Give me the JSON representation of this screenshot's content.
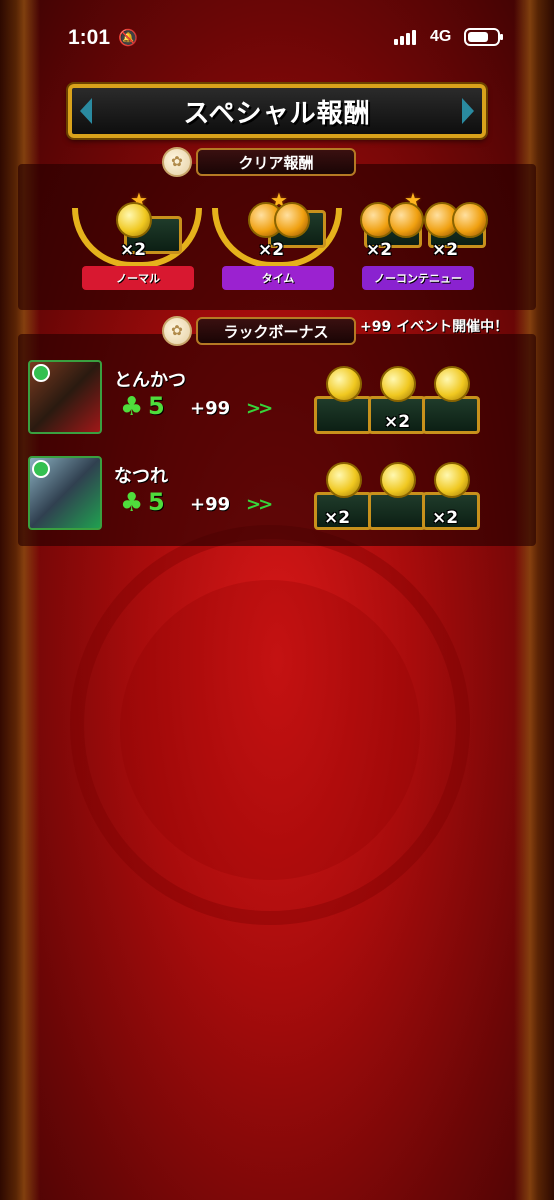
{
  "status": {
    "time": "1:01",
    "network": "4G"
  },
  "title": "スペシャル報酬",
  "clear_reward": {
    "label": "クリア報酬",
    "items": [
      {
        "name": "ノーマル",
        "multiplier": "×2",
        "color": "#d81830"
      },
      {
        "name": "タイム",
        "multiplier": "×2",
        "color": "#9b22d0"
      },
      {
        "name": "ノーコンテニュー",
        "multiplier_left": "×2",
        "multiplier_right": "×2",
        "color": "#8a22d0"
      }
    ]
  },
  "luck_bonus": {
    "label": "ラックボーナス",
    "event_text": "+99 イベント開催中！",
    "rows": [
      {
        "name": "とんかつ",
        "luck": "5",
        "bonus": "+99",
        "rewards": [
          "",
          "×2",
          ""
        ]
      },
      {
        "name": "なつれ",
        "luck": "5",
        "bonus": "+99",
        "rewards": [
          "×2",
          "",
          "×2"
        ]
      }
    ]
  },
  "colors": {
    "gold": "#d9a21b",
    "luck_green": "#4fdd3c",
    "background_red": "#a80c0c"
  }
}
